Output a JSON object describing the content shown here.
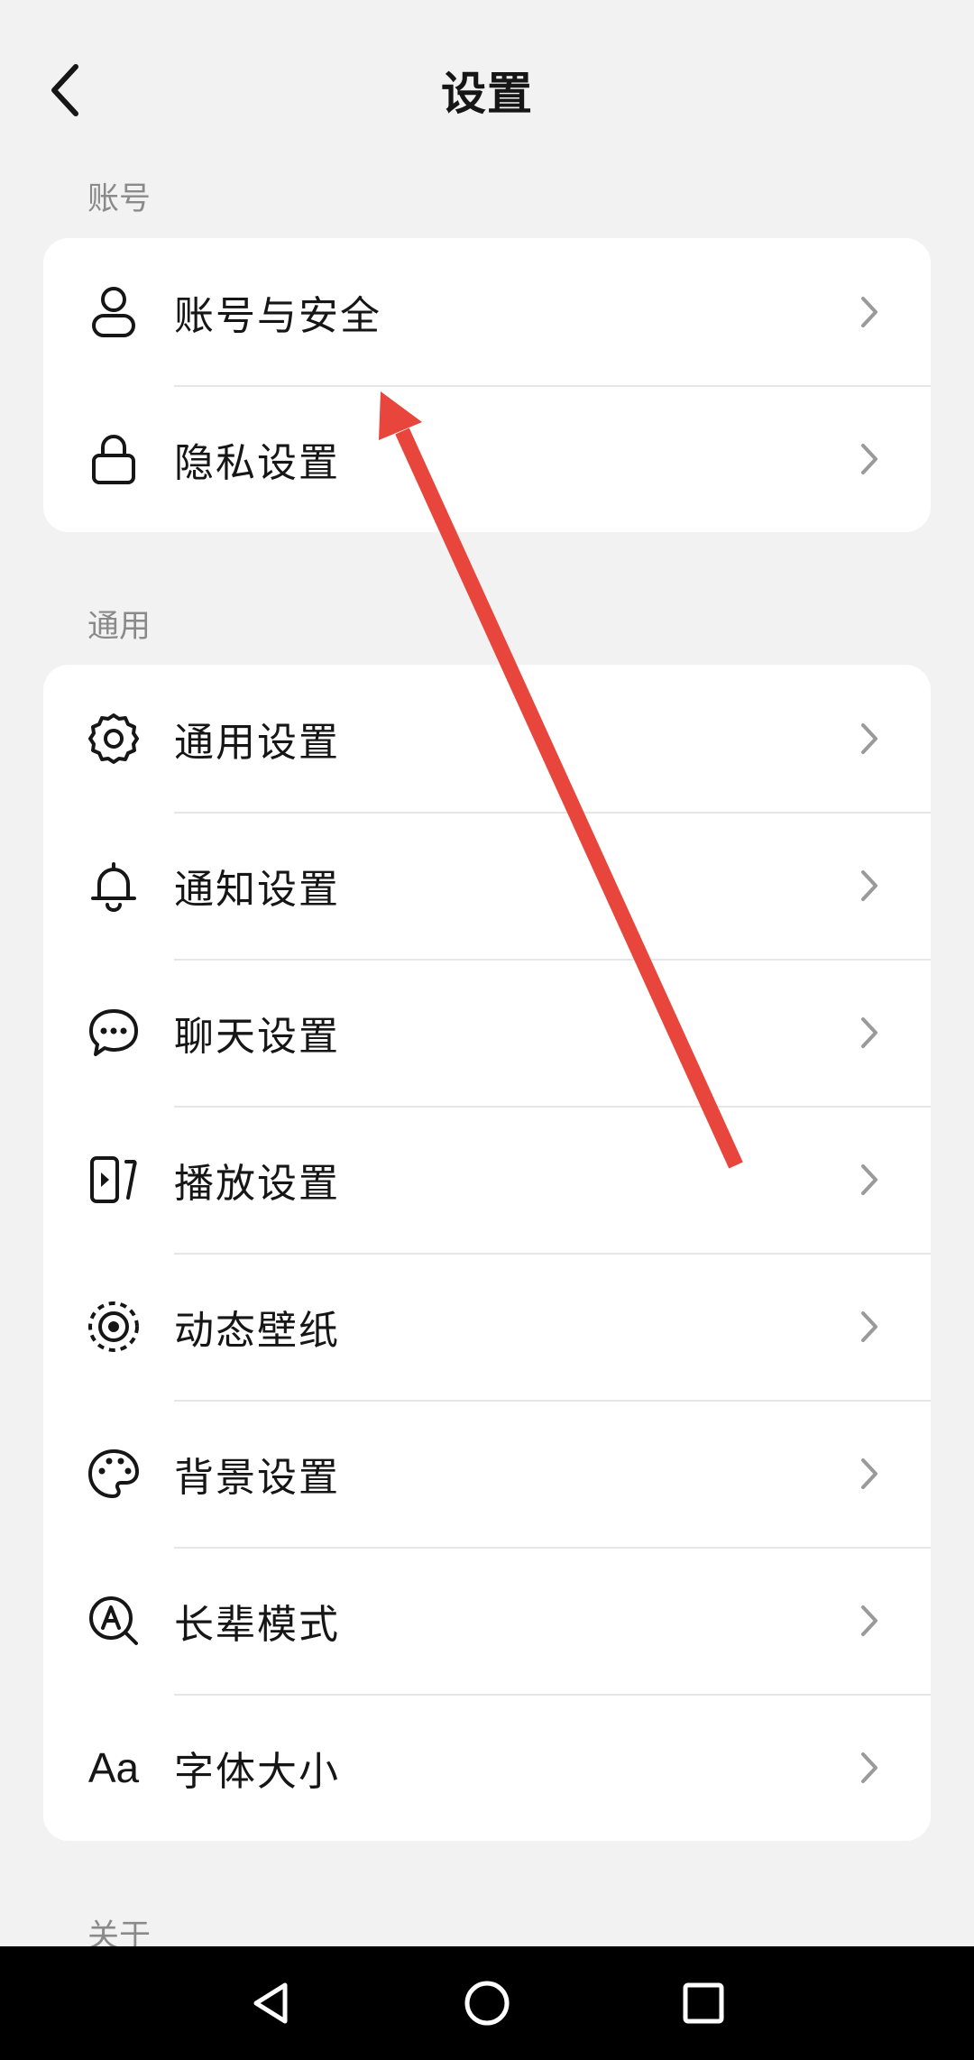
{
  "header": {
    "title": "设置"
  },
  "sections": [
    {
      "label": "账号"
    },
    {
      "label": "通用"
    },
    {
      "label": "关于"
    }
  ],
  "account_items": [
    {
      "label": "账号与安全",
      "icon": "user-icon"
    },
    {
      "label": "隐私设置",
      "icon": "lock-icon"
    }
  ],
  "general_items": [
    {
      "label": "通用设置",
      "icon": "gear-icon"
    },
    {
      "label": "通知设置",
      "icon": "bell-icon"
    },
    {
      "label": "聊天设置",
      "icon": "chat-bubble-icon"
    },
    {
      "label": "播放设置",
      "icon": "play-screen-icon"
    },
    {
      "label": "动态壁纸",
      "icon": "dynamic-wallpaper-icon"
    },
    {
      "label": "背景设置",
      "icon": "palette-icon"
    },
    {
      "label": "长辈模式",
      "icon": "elder-mode-icon"
    },
    {
      "label": "字体大小",
      "icon": "font-size-icon",
      "icon_text": "Aa"
    }
  ],
  "annotation": {
    "type": "arrow",
    "color": "#e8453c"
  },
  "navbar": {
    "buttons": [
      "back-triangle-icon",
      "home-circle-icon",
      "recents-square-icon"
    ]
  }
}
